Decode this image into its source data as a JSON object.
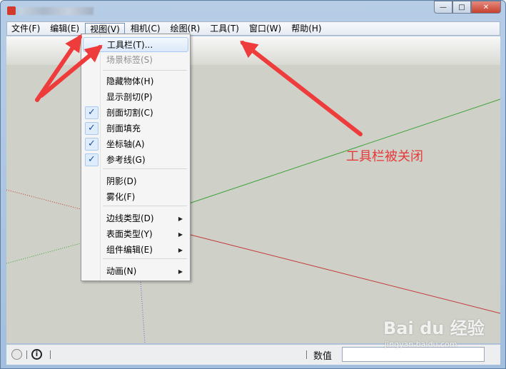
{
  "window": {
    "controls": {
      "minimize": "—",
      "maximize": "□",
      "close": "✕"
    },
    "icon": "app-icon"
  },
  "menubar": {
    "items": [
      {
        "label": "文件(F)",
        "active": false
      },
      {
        "label": "编辑(E)",
        "active": false
      },
      {
        "label": "视图(V)",
        "active": true
      },
      {
        "label": "相机(C)",
        "active": false
      },
      {
        "label": "绘图(R)",
        "active": false
      },
      {
        "label": "工具(T)",
        "active": false
      },
      {
        "label": "窗口(W)",
        "active": false
      },
      {
        "label": "帮助(H)",
        "active": false
      }
    ]
  },
  "view_menu": {
    "items": [
      {
        "label": "工具栏(T)...",
        "checked": false,
        "disabled": false,
        "submenu": false,
        "hover": true
      },
      {
        "label": "场景标签(S)",
        "checked": false,
        "disabled": true,
        "submenu": false,
        "hover": false
      },
      {
        "label": "隐藏物体(H)",
        "checked": false,
        "disabled": false,
        "submenu": false,
        "hover": false
      },
      {
        "label": "显示剖切(P)",
        "checked": false,
        "disabled": false,
        "submenu": false,
        "hover": false
      },
      {
        "label": "剖面切割(C)",
        "checked": true,
        "disabled": false,
        "submenu": false,
        "hover": false
      },
      {
        "label": "剖面填充",
        "checked": true,
        "disabled": false,
        "submenu": false,
        "hover": false
      },
      {
        "label": "坐标轴(A)",
        "checked": true,
        "disabled": false,
        "submenu": false,
        "hover": false
      },
      {
        "label": "参考线(G)",
        "checked": true,
        "disabled": false,
        "submenu": false,
        "hover": false
      },
      {
        "label": "阴影(D)",
        "checked": false,
        "disabled": false,
        "submenu": false,
        "hover": false
      },
      {
        "label": "雾化(F)",
        "checked": false,
        "disabled": false,
        "submenu": false,
        "hover": false
      },
      {
        "label": "边线类型(D)",
        "checked": false,
        "disabled": false,
        "submenu": true,
        "hover": false
      },
      {
        "label": "表面类型(Y)",
        "checked": false,
        "disabled": false,
        "submenu": true,
        "hover": false
      },
      {
        "label": "组件编辑(E)",
        "checked": false,
        "disabled": false,
        "submenu": true,
        "hover": false
      },
      {
        "label": "动画(N)",
        "checked": false,
        "disabled": false,
        "submenu": true,
        "hover": false
      }
    ],
    "check_glyph": "✓",
    "submenu_glyph": "▶"
  },
  "annotation": {
    "text": "工具栏被关闭",
    "color": "#e63a3a"
  },
  "statusbar": {
    "value_label": "数值",
    "value_input": "",
    "bulb_icon": "lightbulb-icon",
    "info_icon": "info-icon",
    "info_glyph": "i"
  },
  "watermark": {
    "brand": "Bai du 经验",
    "url": "jingyan.baidu.com"
  },
  "colors": {
    "axis_green": "#3aa335",
    "axis_red": "#c43a3a",
    "axis_blue": "#6a6ad0",
    "arrow_red": "#ee3b3b",
    "viewport_bg": "#cfd0c8"
  }
}
